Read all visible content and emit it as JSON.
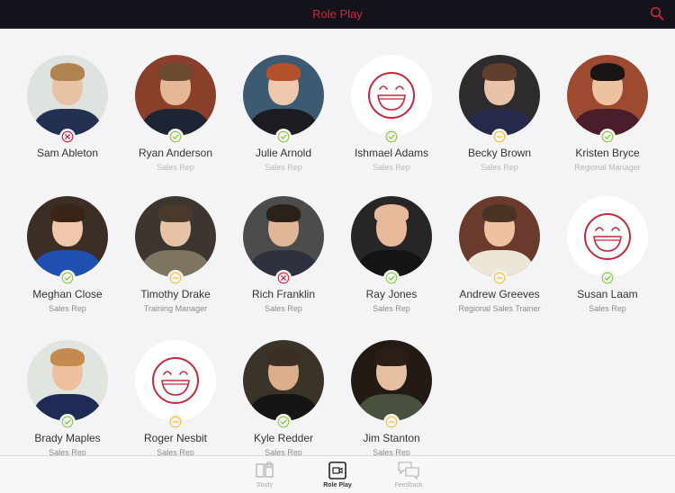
{
  "header": {
    "title": "Role Play",
    "search_icon": "search-icon"
  },
  "colors": {
    "accent": "#c8283c",
    "status_pass": "#8cc63f",
    "status_neutral": "#f2c12e",
    "status_fail": "#d0243c",
    "navbar_bg": "#14131b"
  },
  "people": [
    {
      "name": "Sam Ableton",
      "role": "",
      "status": "fail",
      "avatar": "photo"
    },
    {
      "name": "Ryan Anderson",
      "role": "Sales Rep",
      "status": "pass",
      "avatar": "photo"
    },
    {
      "name": "Julie Arnold",
      "role": "Sales Rep",
      "status": "pass",
      "avatar": "photo"
    },
    {
      "name": "Ishmael Adams",
      "role": "Sales Rep",
      "status": "pass",
      "avatar": "smiley"
    },
    {
      "name": "Becky Brown",
      "role": "Sales Rep",
      "status": "neutral",
      "avatar": "photo"
    },
    {
      "name": "Kristen Bryce",
      "role": "Regional Manager",
      "status": "pass",
      "avatar": "photo"
    },
    {
      "name": "Meghan Close",
      "role": "Sales Rep",
      "status": "pass",
      "avatar": "photo"
    },
    {
      "name": "Timothy Drake",
      "role": "Training Manager",
      "status": "neutral",
      "avatar": "photo"
    },
    {
      "name": "Rich Franklin",
      "role": "Sales Rep",
      "status": "fail",
      "avatar": "photo"
    },
    {
      "name": "Ray Jones",
      "role": "Sales Rep",
      "status": "pass",
      "avatar": "photo"
    },
    {
      "name": "Andrew Greeves",
      "role": "Regional Sales Trainer",
      "status": "neutral",
      "avatar": "photo"
    },
    {
      "name": "Susan Laam",
      "role": "Sales Rep",
      "status": "pass",
      "avatar": "smiley"
    },
    {
      "name": "Brady Maples",
      "role": "Sales Rep",
      "status": "pass",
      "avatar": "photo"
    },
    {
      "name": "Roger Nesbit",
      "role": "Sales Rep",
      "status": "neutral",
      "avatar": "smiley"
    },
    {
      "name": "Kyle Redder",
      "role": "Sales Rep",
      "status": "pass",
      "avatar": "photo"
    },
    {
      "name": "Jim Stanton",
      "role": "Sales Rep",
      "status": "neutral",
      "avatar": "photo"
    }
  ],
  "tabs": [
    {
      "label": "Study",
      "icon": "book-icon",
      "active": false
    },
    {
      "label": "Role Play",
      "icon": "video-camera-icon",
      "active": true
    },
    {
      "label": "Feedback",
      "icon": "chat-bubbles-icon",
      "active": false
    }
  ]
}
